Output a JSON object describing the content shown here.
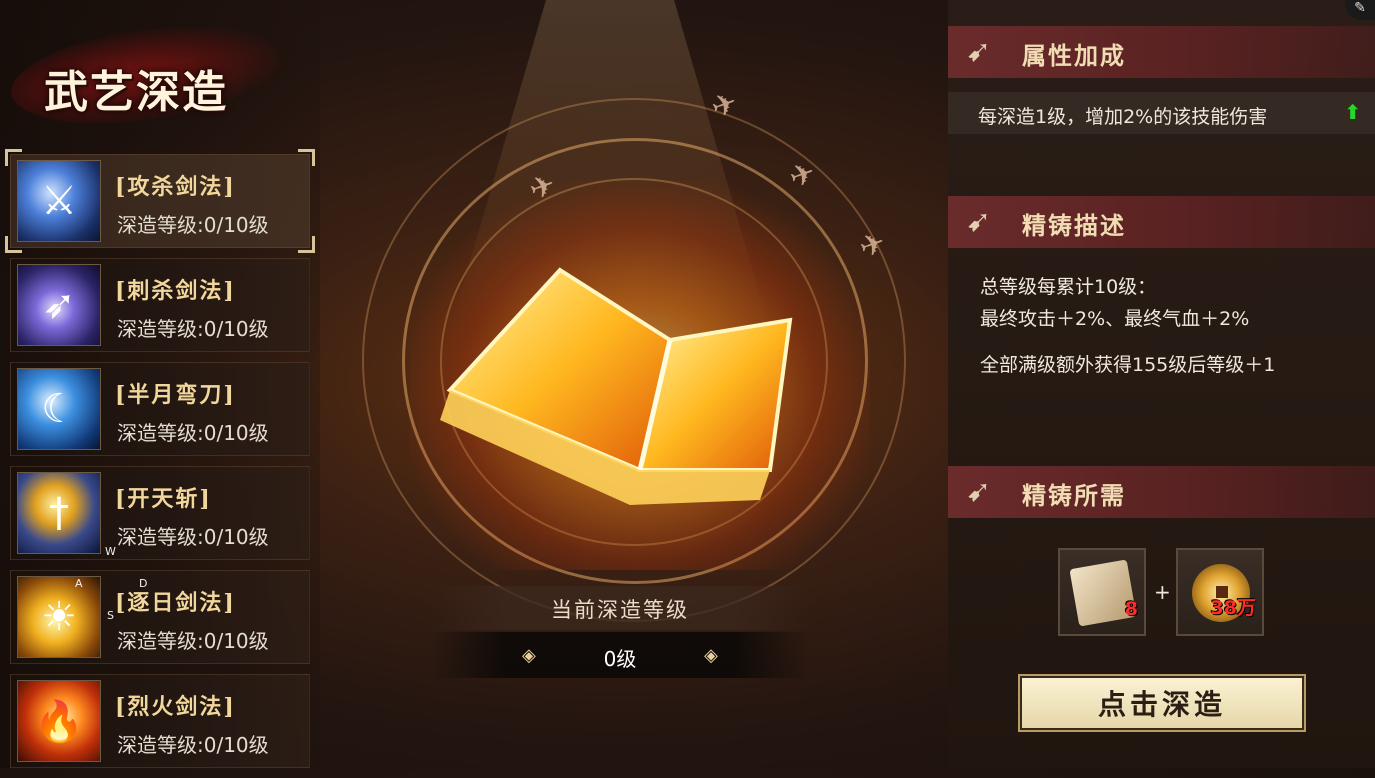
{
  "header": {
    "title": "武艺深造"
  },
  "skills": [
    {
      "name": "[攻杀剑法]",
      "level": "深造等级:0/10级",
      "icon": "sword-slash-icon",
      "selected": true
    },
    {
      "name": "[刺杀剑法]",
      "level": "深造等级:0/10级",
      "icon": "thrust-blade-icon",
      "selected": false
    },
    {
      "name": "[半月弯刀]",
      "level": "深造等级:0/10级",
      "icon": "crescent-blade-icon",
      "selected": false
    },
    {
      "name": "[开天斩]",
      "level": "深造等级:0/10级",
      "icon": "heaven-sword-icon",
      "selected": false
    },
    {
      "name": "[逐日剑法]",
      "level": "深造等级:0/10级",
      "icon": "sun-sword-icon",
      "selected": false
    },
    {
      "name": "[烈火剑法]",
      "level": "深造等级:0/10级",
      "icon": "fire-sword-icon",
      "selected": false
    }
  ],
  "overlay_keys": {
    "w": "W",
    "a": "A",
    "d": "D",
    "s": "S"
  },
  "center": {
    "level_label": "当前深造等级",
    "level_value": "0级",
    "emblem": "flaming-book-icon"
  },
  "attributes": {
    "title": "属性加成",
    "bonus": "每深造1级，增加2%的该技能伤害",
    "bonus_indicator": "up-arrow-icon"
  },
  "refine_desc": {
    "title": "精铸描述",
    "line1": "总等级每累计10级：",
    "line2": "最终攻击＋2%、最终气血＋2%",
    "line3": "全部满级额外获得155级后等级＋1"
  },
  "requirements": {
    "title": "精铸所需",
    "items": [
      {
        "icon": "scroll-icon",
        "count": "8"
      },
      {
        "icon": "gold-coin-icon",
        "count": "38万"
      }
    ],
    "plus": "+"
  },
  "action": {
    "label": "点击深造"
  },
  "colors": {
    "accent_gold": "#f2d79c",
    "header_red": "#6a2b2b",
    "count_red": "#ff2a2a",
    "arrow_green": "#27d82a",
    "button_bg": "#fbf3d6"
  }
}
